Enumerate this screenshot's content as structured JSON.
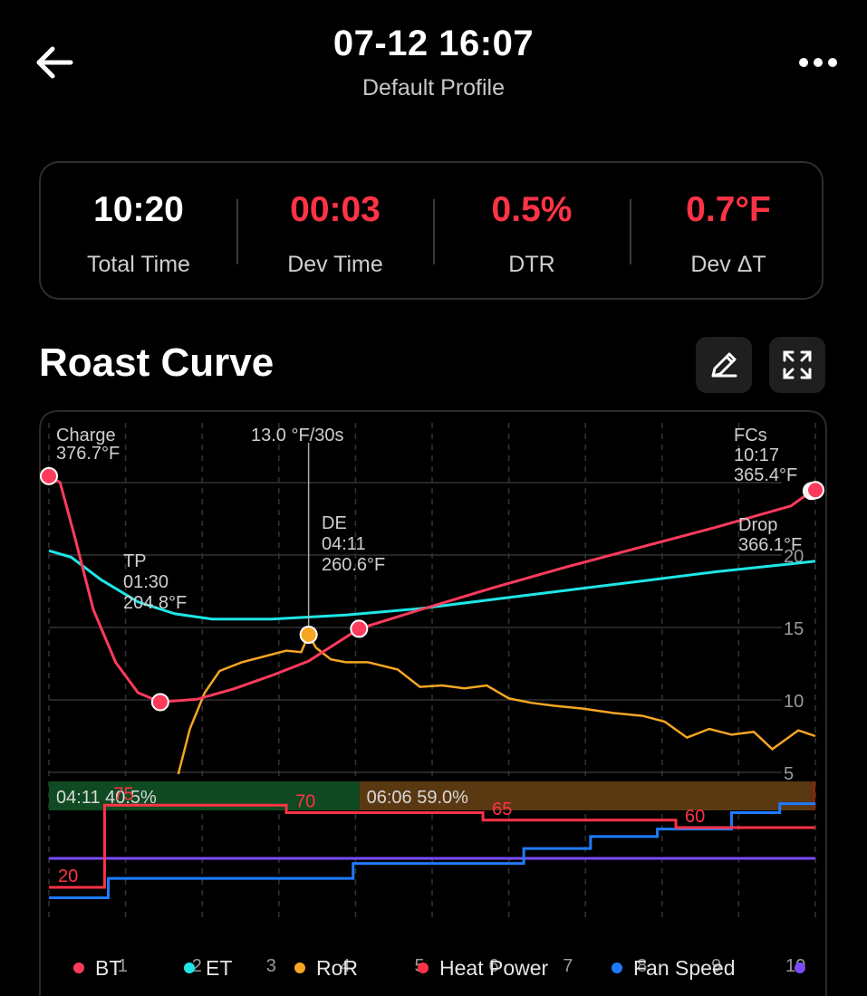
{
  "header": {
    "title": "07-12 16:07",
    "subtitle": "Default Profile"
  },
  "stats": [
    {
      "value": "10:20",
      "label": "Total Time",
      "color": "#ffffff"
    },
    {
      "value": "00:03",
      "label": "Dev Time",
      "color": "#ff3346"
    },
    {
      "value": "0.5%",
      "label": "DTR",
      "color": "#ff3346"
    },
    {
      "value": "0.7°F",
      "label": "Dev ΔT",
      "color": "#ff3346"
    }
  ],
  "section": {
    "title": "Roast Curve"
  },
  "icons": {
    "back": "arrow-left-icon",
    "more": "more-horizontal-icon",
    "edit": "pencil-icon",
    "expand": "expand-icon"
  },
  "colors": {
    "bt": "#ff3b5c",
    "et": "#1ee6e6",
    "ror": "#f5a623",
    "heat": "#ff3346",
    "fan": "#1e7bff",
    "purple": "#7a4bff",
    "phase_dry": "#0f4a22",
    "phase_mai": "#5a3812"
  },
  "chart_data": {
    "type": "line",
    "x_ticks": [
      "1",
      "2",
      "3",
      "4",
      "5",
      "6",
      "7",
      "8",
      "9",
      "10"
    ],
    "ror_ticks": [
      "20",
      "15",
      "10",
      "5"
    ],
    "xlim": [
      0,
      10.33
    ],
    "ror_lim": [
      2.5,
      20
    ],
    "series": [
      {
        "key": "BT",
        "points": [
          [
            0,
            376.7
          ],
          [
            0.15,
            372
          ],
          [
            0.35,
            330
          ],
          [
            0.6,
            275
          ],
          [
            0.9,
            235
          ],
          [
            1.2,
            212
          ],
          [
            1.5,
            204.8
          ],
          [
            2,
            207
          ],
          [
            2.5,
            215
          ],
          [
            3,
            225
          ],
          [
            3.5,
            236
          ],
          [
            4.18,
            260.6
          ],
          [
            5,
            275
          ],
          [
            6,
            292
          ],
          [
            7,
            308
          ],
          [
            8,
            323
          ],
          [
            9,
            338
          ],
          [
            10,
            354
          ],
          [
            10.28,
            365.4
          ],
          [
            10.33,
            366.1
          ]
        ]
      },
      {
        "key": "ET",
        "points": [
          [
            0,
            320
          ],
          [
            0.3,
            315
          ],
          [
            0.7,
            298
          ],
          [
            1.2,
            281
          ],
          [
            1.7,
            272
          ],
          [
            2.2,
            268
          ],
          [
            3,
            268
          ],
          [
            4,
            271
          ],
          [
            5,
            276
          ],
          [
            6,
            283
          ],
          [
            7,
            290
          ],
          [
            8,
            297
          ],
          [
            9,
            304
          ],
          [
            10,
            310
          ],
          [
            10.33,
            312
          ]
        ]
      },
      {
        "key": "RoR",
        "points": [
          [
            1.62,
            0
          ],
          [
            1.75,
            5
          ],
          [
            1.9,
            8
          ],
          [
            2.1,
            10.5
          ],
          [
            2.3,
            12
          ],
          [
            2.6,
            12.6
          ],
          [
            2.9,
            13
          ],
          [
            3.2,
            13.4
          ],
          [
            3.4,
            13.3
          ],
          [
            3.5,
            14.5
          ],
          [
            3.6,
            13.6
          ],
          [
            3.8,
            12.8
          ],
          [
            4.0,
            12.6
          ],
          [
            4.3,
            12.6
          ],
          [
            4.7,
            12.1
          ],
          [
            5.0,
            10.9
          ],
          [
            5.3,
            11
          ],
          [
            5.6,
            10.8
          ],
          [
            5.9,
            11.0
          ],
          [
            6.2,
            10.1
          ],
          [
            6.5,
            9.8
          ],
          [
            6.8,
            9.6
          ],
          [
            7.2,
            9.4
          ],
          [
            7.6,
            9.1
          ],
          [
            8.0,
            8.9
          ],
          [
            8.3,
            8.5
          ],
          [
            8.6,
            7.4
          ],
          [
            8.9,
            8.0
          ],
          [
            9.2,
            7.6
          ],
          [
            9.5,
            7.8
          ],
          [
            9.75,
            6.6
          ],
          [
            10.1,
            7.9
          ],
          [
            10.33,
            7.5
          ]
        ]
      }
    ],
    "heat_power": {
      "steps": [
        [
          0,
          20
        ],
        [
          0.75,
          75
        ],
        [
          3.2,
          70
        ],
        [
          5.85,
          65
        ],
        [
          8.45,
          60
        ],
        [
          10.33,
          60
        ]
      ]
    },
    "fan_speed": {
      "steps": [
        [
          0,
          13
        ],
        [
          0.8,
          26
        ],
        [
          4.1,
          36
        ],
        [
          6.4,
          46
        ],
        [
          7.3,
          54
        ],
        [
          8.2,
          59
        ],
        [
          9.2,
          70
        ],
        [
          9.85,
          76
        ],
        [
          10.33,
          76
        ]
      ]
    },
    "events": [
      {
        "name": "Charge",
        "time": null,
        "temp": "376.7°F"
      },
      {
        "name": "TP",
        "time": "01:30",
        "temp": "204.8°F"
      },
      {
        "name": "DE",
        "time": "04:11",
        "temp": "260.6°F"
      },
      {
        "name": "FCs",
        "time": "10:17",
        "temp": "365.4°F"
      },
      {
        "name": "Drop",
        "time": null,
        "temp": "366.1°F"
      }
    ],
    "ror_peak_label": "13.0 °F/30s",
    "phases": [
      {
        "label": "04:11 40.5%",
        "fraction": 0.405
      },
      {
        "label": "06:06 59.0%",
        "fraction": 0.59
      }
    ],
    "heat_labels": [
      "75",
      "70",
      "65",
      "60",
      "20"
    ],
    "legend": [
      "BT",
      "ET",
      "RoR",
      "Heat Power",
      "Fan Speed"
    ]
  }
}
